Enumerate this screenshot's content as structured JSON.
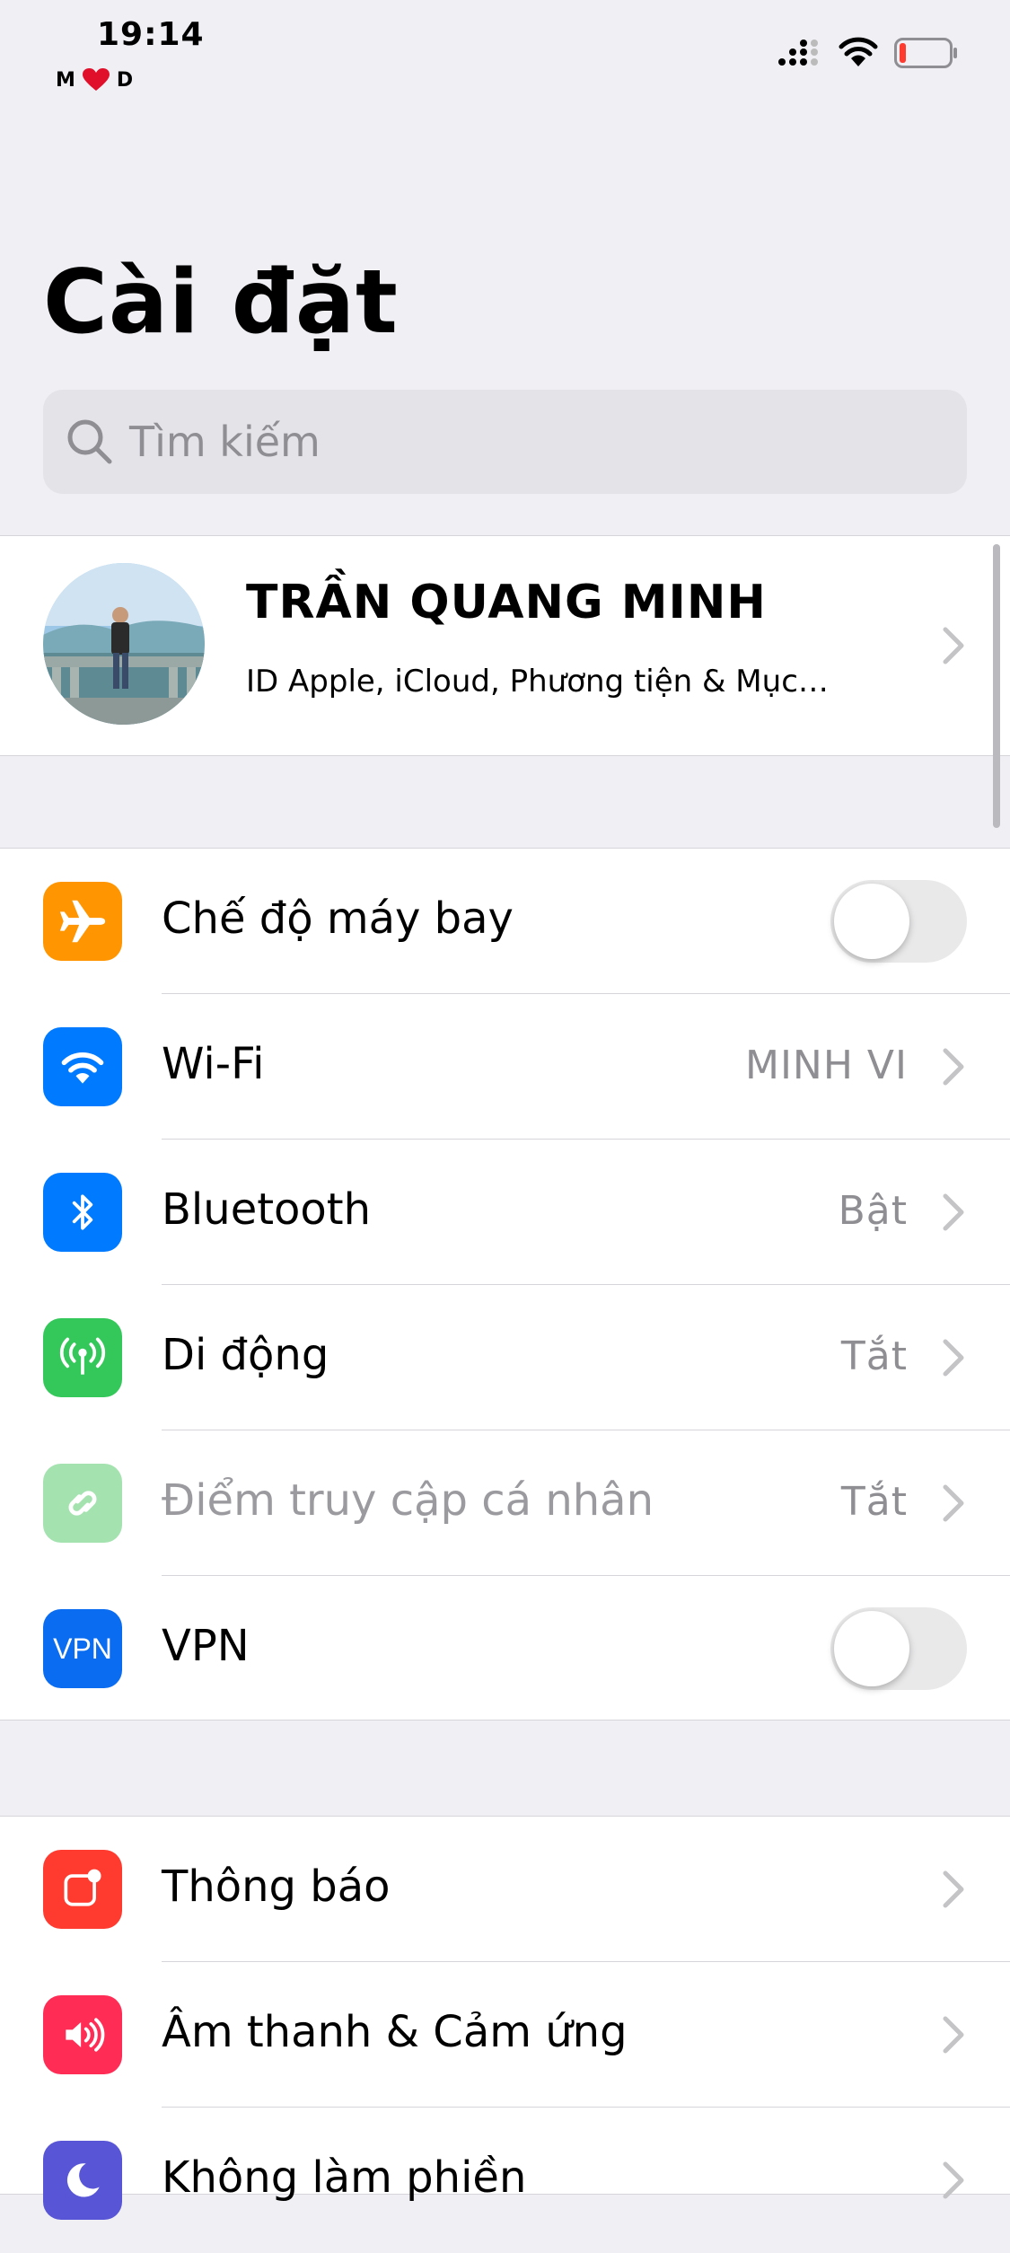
{
  "status_bar": {
    "time": "19:14",
    "carrier_left": "M",
    "carrier_right": "D",
    "battery_color": "#ff3b30"
  },
  "page_title": "Cài đặt",
  "search": {
    "placeholder": "Tìm kiếm"
  },
  "profile": {
    "name": "TRẦN QUANG MINH",
    "subtitle": "ID Apple, iCloud, Phương tiện & Mục…"
  },
  "network_section": [
    {
      "label": "Chế độ máy bay",
      "icon": "airplane-icon",
      "color": "#ff9500",
      "control": "toggle",
      "toggle_on": false
    },
    {
      "label": "Wi-Fi",
      "icon": "wifi-icon",
      "color": "#007aff",
      "value": "MINH VI"
    },
    {
      "label": "Bluetooth",
      "icon": "bluetooth-icon",
      "color": "#007aff",
      "value": "Bật"
    },
    {
      "label": "Di động",
      "icon": "antenna-icon",
      "color": "#34c759",
      "value": "Tắt"
    },
    {
      "label": "Điểm truy cập cá nhân",
      "icon": "hotspot-icon",
      "color": "#a4e2b0",
      "value": "Tắt",
      "disabled": true
    },
    {
      "label": "VPN",
      "icon": "vpn-icon",
      "icon_text": "VPN",
      "color": "#0a6cf0",
      "control": "toggle",
      "toggle_on": false
    }
  ],
  "notifications_section": [
    {
      "label": "Thông báo",
      "icon": "notifications-icon",
      "color": "#ff3b30"
    },
    {
      "label": "Âm thanh & Cảm ứng",
      "icon": "speaker-icon",
      "color": "#ff2d55"
    },
    {
      "label": "Không làm phiền",
      "icon": "moon-icon",
      "color": "#5856d6"
    }
  ]
}
